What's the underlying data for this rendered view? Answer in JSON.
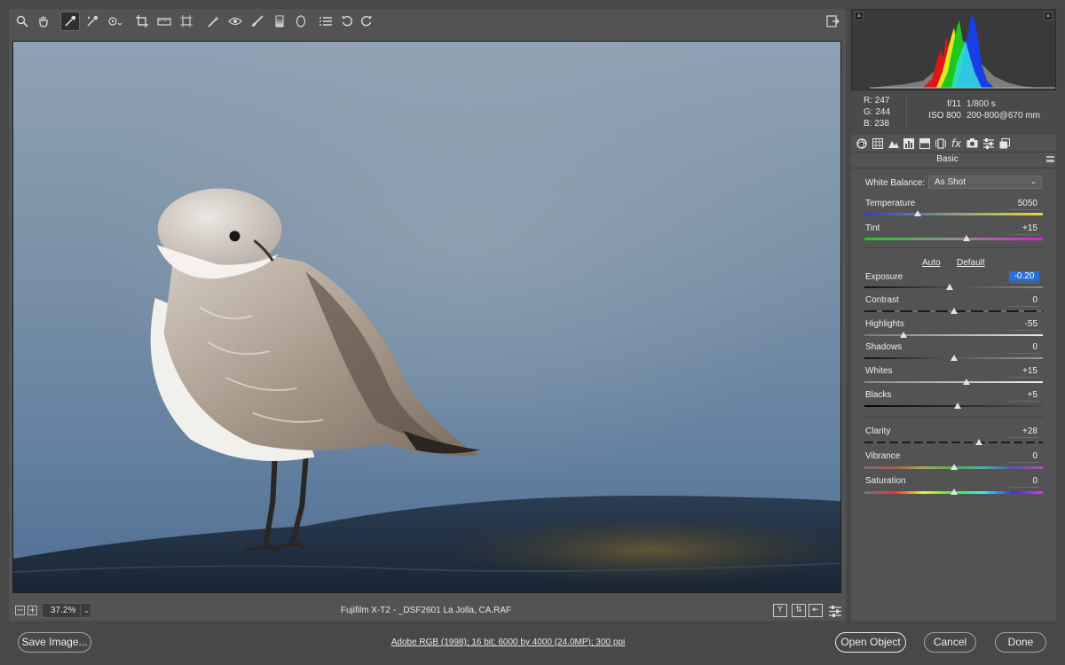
{
  "toolbar": {
    "tools": [
      {
        "name": "zoom-tool",
        "icon": "magnifier-icon",
        "glyph": "🔍"
      },
      {
        "name": "hand-tool",
        "icon": "hand-icon",
        "glyph": "✋"
      },
      {
        "name": "white-balance-tool",
        "icon": "eyedropper-icon",
        "glyph": "✎"
      },
      {
        "name": "color-sampler-tool",
        "icon": "color-sampler-icon",
        "glyph": "✎"
      },
      {
        "name": "targeted-adjustment-tool",
        "icon": "target-adjust-icon",
        "glyph": "⊙"
      },
      {
        "name": "crop-tool",
        "icon": "crop-icon",
        "glyph": "⌗"
      },
      {
        "name": "straighten-tool",
        "icon": "straighten-icon",
        "glyph": "▭"
      },
      {
        "name": "transform-tool",
        "icon": "transform-icon",
        "glyph": "⊡"
      },
      {
        "name": "spot-removal-tool",
        "icon": "spot-removal-icon",
        "glyph": "✐"
      },
      {
        "name": "red-eye-tool",
        "icon": "red-eye-icon",
        "glyph": "◎"
      },
      {
        "name": "adjustment-brush-tool",
        "icon": "brush-icon",
        "glyph": "🖌"
      },
      {
        "name": "graduated-filter-tool",
        "icon": "graduated-filter-icon",
        "glyph": "▯"
      },
      {
        "name": "radial-filter-tool",
        "icon": "radial-filter-icon",
        "glyph": "⬯"
      },
      {
        "name": "preferences-tool",
        "icon": "list-icon",
        "glyph": "☰"
      },
      {
        "name": "rotate-ccw-tool",
        "icon": "rotate-ccw-icon",
        "glyph": "↺"
      },
      {
        "name": "rotate-cw-tool",
        "icon": "rotate-cw-icon",
        "glyph": "↻"
      }
    ],
    "fullscreen_icon": "fullscreen-icon"
  },
  "status": {
    "zoom": "37.2%",
    "filename": "Fujifilm X-T2  -  _DSF2601 La Jolla, CA.RAF"
  },
  "info": {
    "r": "R:  247",
    "g": "G:  244",
    "b": "B:  238",
    "aperture": "f/11",
    "shutter": "1/800 s",
    "iso": "ISO 800",
    "lens": "200-800@670 mm"
  },
  "panel": {
    "title": "Basic",
    "white_balance_label": "White Balance:",
    "white_balance_value": "As Shot",
    "auto_label": "Auto",
    "default_label": "Default",
    "sliders": {
      "temperature": {
        "label": "Temperature",
        "value": "5050",
        "position": 0.3
      },
      "tint": {
        "label": "Tint",
        "value": "+15",
        "position": 0.57
      },
      "exposure": {
        "label": "Exposure",
        "value": "-0.20",
        "position": 0.48
      },
      "contrast": {
        "label": "Contrast",
        "value": "0",
        "position": 0.5
      },
      "highlights": {
        "label": "Highlights",
        "value": "-55",
        "position": 0.22
      },
      "shadows": {
        "label": "Shadows",
        "value": "0",
        "position": 0.5
      },
      "whites": {
        "label": "Whites",
        "value": "+15",
        "position": 0.57
      },
      "blacks": {
        "label": "Blacks",
        "value": "+5",
        "position": 0.52
      },
      "clarity": {
        "label": "Clarity",
        "value": "+28",
        "position": 0.64
      },
      "vibrance": {
        "label": "Vibrance",
        "value": "0",
        "position": 0.5
      },
      "saturation": {
        "label": "Saturation",
        "value": "0",
        "position": 0.5
      }
    }
  },
  "bottom": {
    "save_label": "Save Image...",
    "image_info": "Adobe RGB (1998); 16 bit; 6000 by 4000 (24.0MP); 300 ppi",
    "open_label": "Open Object",
    "cancel_label": "Cancel",
    "done_label": "Done"
  },
  "colors": {
    "accent_selected": "#2a6fd1",
    "panel_bg": "#535353",
    "window_bg": "#484848"
  }
}
